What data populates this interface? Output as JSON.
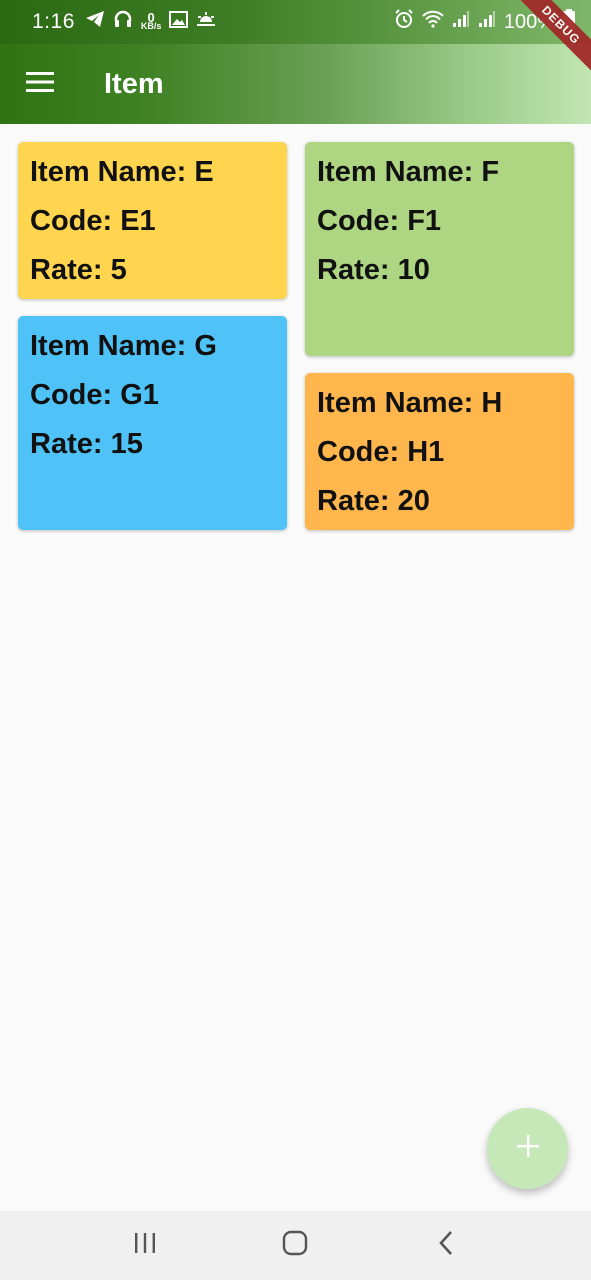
{
  "status_bar": {
    "time": "1:16",
    "net_speed_value": "0",
    "net_speed_unit": "KB/s",
    "battery_text": "100%"
  },
  "app_bar": {
    "title": "Item",
    "debug_label": "DEBUG"
  },
  "items": [
    {
      "name": "Item Name: E",
      "code": "Code: E1",
      "rate": "Rate: 5",
      "color": "#ffd54f"
    },
    {
      "name": "Item Name: F",
      "code": "Code: F1",
      "rate": "Rate: 10",
      "color": "#aed581"
    },
    {
      "name": "Item Name: G",
      "code": "Code: G1",
      "rate": "Rate: 15",
      "color": "#4fc3f7"
    },
    {
      "name": "Item Name: H",
      "code": "Code: H1",
      "rate": "Rate: 20",
      "color": "#ffb74d"
    }
  ],
  "colors": {
    "app_bar_start": "#2f7312",
    "app_bar_end": "#c2e6b3",
    "fab": "#c6e8b8"
  },
  "icons": {
    "menu": "menu-icon",
    "fab": "plus-icon",
    "nav_recent": "recent-apps-icon",
    "nav_home": "home-icon",
    "nav_back": "back-icon"
  }
}
